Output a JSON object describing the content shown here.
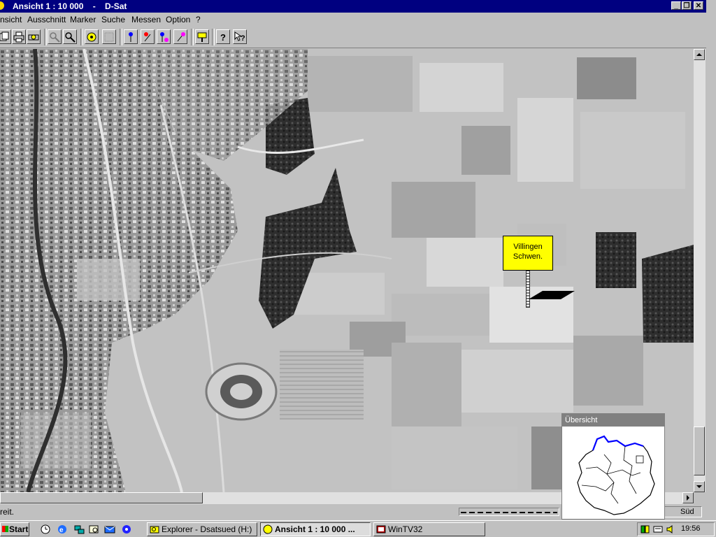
{
  "window": {
    "title": "Ansicht 1 : 10 000    -    D-Sat",
    "minimize_label": "_",
    "maximize_label": "❐",
    "close_label": "✕"
  },
  "menu": {
    "items": [
      {
        "label": "nsicht"
      },
      {
        "label": "Ausschnitt"
      },
      {
        "label": "Marker"
      },
      {
        "label": "Suche"
      },
      {
        "label": "Messen"
      },
      {
        "label": "Option"
      },
      {
        "label": "?"
      }
    ]
  },
  "toolbar": {
    "buttons": [
      {
        "icon": "copy-icon"
      },
      {
        "icon": "print-icon"
      },
      {
        "icon": "print-preview-icon"
      },
      {
        "icon": "zoom-in-icon"
      },
      {
        "icon": "zoom-out-icon"
      },
      {
        "icon": "lens-icon"
      },
      {
        "icon": "grid-icon"
      },
      {
        "icon": "marker-blue-icon"
      },
      {
        "icon": "marker-red-icon"
      },
      {
        "icon": "marker-multi-icon"
      },
      {
        "icon": "marker-pink-icon"
      },
      {
        "icon": "sign-icon"
      },
      {
        "icon": "help-icon"
      },
      {
        "icon": "context-help-icon"
      }
    ]
  },
  "map": {
    "marker_label_line1": "Villingen",
    "marker_label_line2": "Schwen."
  },
  "statusbar": {
    "text": "reit.",
    "direction": "Süd"
  },
  "overview": {
    "title": "Übersicht"
  },
  "taskbar": {
    "start_label": "Start",
    "tasks": [
      {
        "label": "Explorer - Dsatsued (H:)",
        "active": false
      },
      {
        "label": "Ansicht 1 : 10 000 ...",
        "active": true
      },
      {
        "label": "WinTV32",
        "active": false
      }
    ],
    "clock": "19:56"
  },
  "colors": {
    "titlebar": "#000080",
    "marker_label_bg": "#ffff00",
    "overview_title_bg": "#808080",
    "overview_border_highlight": "#0000ff"
  }
}
